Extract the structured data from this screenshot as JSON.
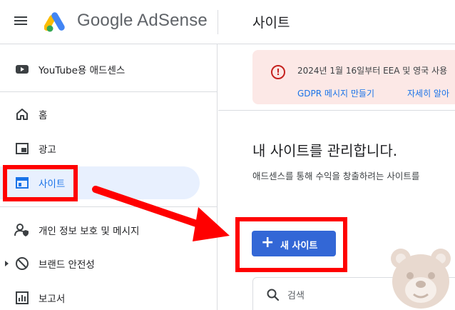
{
  "header": {
    "logo_text": "Google AdSense",
    "page_title": "사이트"
  },
  "sidebar": {
    "items": [
      {
        "label": "YouTube용 애드센스",
        "icon": "youtube-icon"
      },
      {
        "label": "홈",
        "icon": "home-icon"
      },
      {
        "label": "광고",
        "icon": "ads-icon"
      },
      {
        "label": "사이트",
        "icon": "sites-icon",
        "active": true
      },
      {
        "label": "개인 정보 보호 및 메시지",
        "icon": "privacy-icon"
      },
      {
        "label": "브랜드 안전성",
        "icon": "block-icon"
      },
      {
        "label": "보고서",
        "icon": "reports-icon"
      }
    ]
  },
  "notice": {
    "text": "2024년 1월 16일부터 EEA 및 영국 사용",
    "link_gdpr": "GDPR 메시지 만들기",
    "link_more": "자세히 알아"
  },
  "main": {
    "heading": "내 사이트를 관리합니다.",
    "subtext": "애드센스를 통해 수익을 창출하려는 사이트를",
    "new_site_label": "새 사이트",
    "new_site_plus": "+",
    "search_placeholder": "검색"
  },
  "colors": {
    "annotation_red": "#ff0000",
    "primary_button": "#3367d6",
    "active_nav_bg": "#e8f0fe",
    "notice_bg": "#fce8e6"
  }
}
